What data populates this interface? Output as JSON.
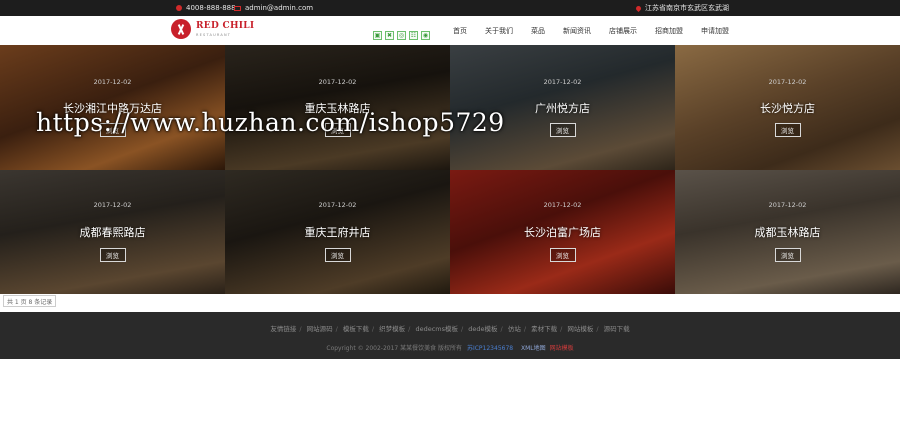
{
  "topbar": {
    "phone": "4008-888-888",
    "email": "admin@admin.com",
    "address": "江苏省南京市玄武区玄武湖"
  },
  "logo": {
    "name": "RED CHILI",
    "sub": "RESTAURANT"
  },
  "nav": [
    "首页",
    "关于我们",
    "菜品",
    "新闻资讯",
    "店铺展示",
    "招商加盟",
    "申请加盟"
  ],
  "share_icons": [
    "bookmark-icon",
    "weibo-icon",
    "wechat-icon",
    "tencent-icon",
    "qzone-icon"
  ],
  "share_glyphs": [
    "▣",
    "✖",
    "◎",
    "☷",
    "◉"
  ],
  "stores": [
    {
      "date": "2017-12-02",
      "name": "长沙湘江中路万达店",
      "btn": "浏览"
    },
    {
      "date": "2017-12-02",
      "name": "重庆玉林路店",
      "btn": "浏览"
    },
    {
      "date": "2017-12-02",
      "name": "广州悦方店",
      "btn": "浏览"
    },
    {
      "date": "2017-12-02",
      "name": "长沙悦方店",
      "btn": "浏览"
    },
    {
      "date": "2017-12-02",
      "name": "成都春熙路店",
      "btn": "浏览"
    },
    {
      "date": "2017-12-02",
      "name": "重庆王府井店",
      "btn": "浏览"
    },
    {
      "date": "2017-12-02",
      "name": "长沙泊富广场店",
      "btn": "浏览"
    },
    {
      "date": "2017-12-02",
      "name": "成都玉林路店",
      "btn": "浏览"
    }
  ],
  "watermark": "https://www.huzhan.com/ishop5729",
  "pagination": "共 1 页 8 条记录",
  "footer": {
    "links": [
      "友情链接",
      "网站源码",
      "模板下载",
      "织梦模板",
      "dedecms模板",
      "dede模板",
      "仿站",
      "素材下载",
      "网站模板",
      "源码下载"
    ],
    "copyright": "Copyright © 2002-2017 某某餐饮美食 版权所有",
    "icp": "苏ICP12345678",
    "xml": "XML地图",
    "map": "网站模板"
  },
  "colors": {
    "brand": "#c8202a",
    "topbar": "#1d1d1d",
    "footer": "#2a2a2a"
  }
}
